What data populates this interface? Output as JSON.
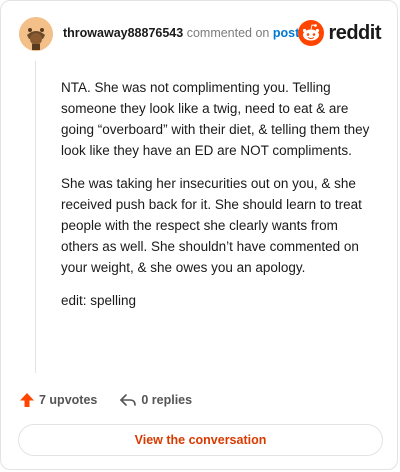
{
  "header": {
    "username": "throwaway88876543",
    "verb": "commented on",
    "post_link": "post",
    "logo_text": "reddit"
  },
  "comment": {
    "paragraphs": [
      "NTA. She was not complimenting you. Telling someone they look like a twig, need to eat & are going “overboard” with their diet, & telling them they look like they have an ED are NOT compliments.",
      "She was taking her insecurities out on you, & she received push back for it. She should learn to treat people with the respect she clearly wants from others as well. She shouldn’t have commented on your weight, & she owes you an apology.",
      "edit: spelling"
    ]
  },
  "actions": {
    "upvotes": "7 upvotes",
    "replies": "0 replies"
  },
  "cta": {
    "label": "View the conversation"
  },
  "colors": {
    "accent_orange": "#ff4500",
    "link_blue": "#0079d3",
    "cta_text": "#d93a00"
  }
}
